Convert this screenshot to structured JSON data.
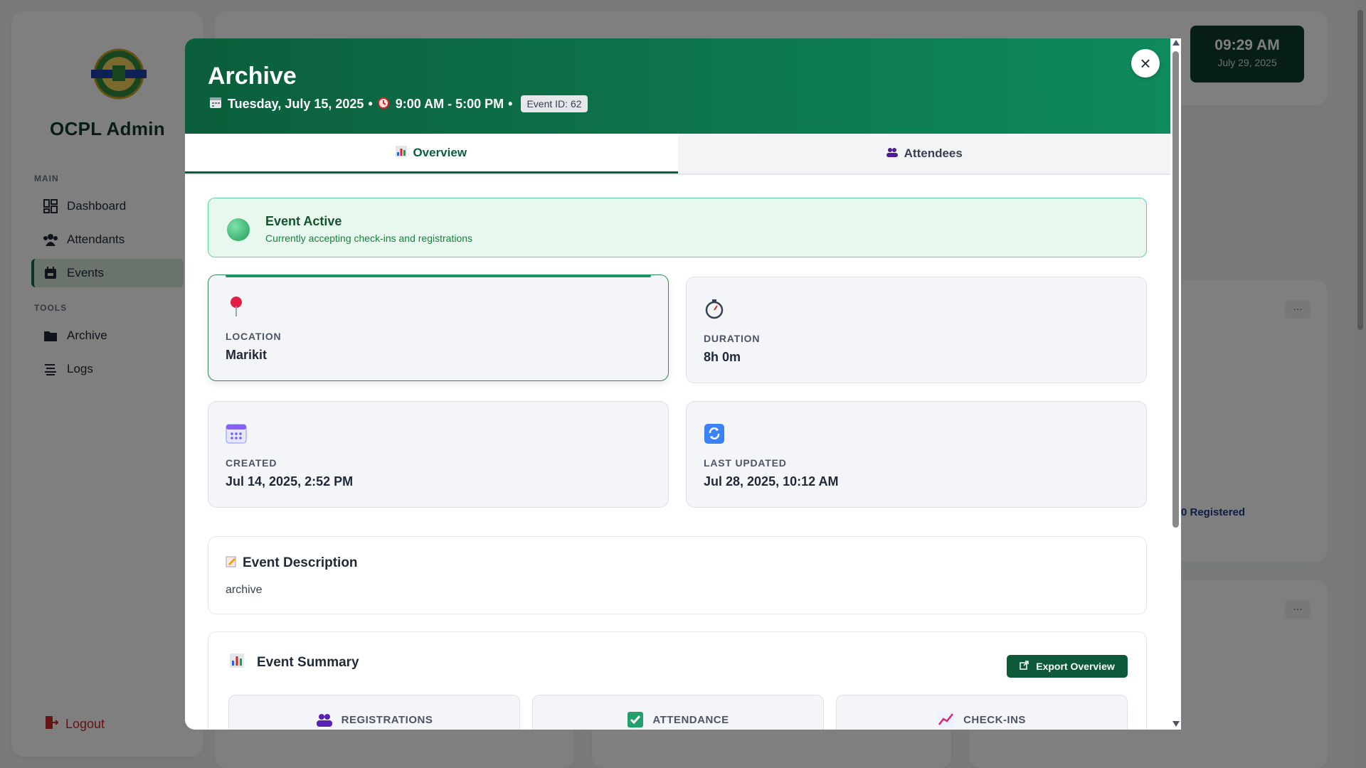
{
  "app": {
    "brand": "OCPL Admin",
    "logo_alt": "Olongapo City Public Library"
  },
  "sidebar": {
    "sections": [
      {
        "label": "MAIN",
        "items": [
          {
            "label": "Dashboard",
            "icon": "dashboard-icon",
            "active": false
          },
          {
            "label": "Attendants",
            "icon": "users-icon",
            "active": false
          },
          {
            "label": "Events",
            "icon": "calendar-icon",
            "active": true
          }
        ]
      },
      {
        "label": "TOOLS",
        "items": [
          {
            "label": "Archive",
            "icon": "folder-icon",
            "active": false
          },
          {
            "label": "Logs",
            "icon": "list-icon",
            "active": false
          }
        ]
      }
    ],
    "logout": "Logout"
  },
  "clock": {
    "time": "09:29 AM",
    "date": "July 29, 2025"
  },
  "background": {
    "registered": "0 Registered",
    "more": "..."
  },
  "modal": {
    "title": "Archive",
    "date": "Tuesday, July 15, 2025",
    "time": "9:00 AM - 5:00 PM",
    "bullet": "•",
    "event_id": "Event ID: 62",
    "close": "×",
    "tabs": [
      {
        "label": "Overview",
        "icon": "chart-icon",
        "active": true
      },
      {
        "label": "Attendees",
        "icon": "people-icon",
        "active": false
      }
    ],
    "status": {
      "title": "Event Active",
      "subtitle": "Currently accepting check-ins and registrations"
    },
    "info": {
      "location": {
        "label": "LOCATION",
        "value": "Marikit"
      },
      "duration": {
        "label": "DURATION",
        "value": "8h 0m"
      },
      "created": {
        "label": "CREATED",
        "value": "Jul 14, 2025, 2:52 PM"
      },
      "updated": {
        "label": "LAST UPDATED",
        "value": "Jul 28, 2025, 10:12 AM"
      }
    },
    "description": {
      "title": "Event Description",
      "text": "archive"
    },
    "summary": {
      "title": "Event Summary",
      "export": "Export Overview",
      "stats": [
        {
          "label": "REGISTRATIONS",
          "icon": "people-icon"
        },
        {
          "label": "ATTENDANCE",
          "icon": "check-icon"
        },
        {
          "label": "CHECK-INS",
          "icon": "trend-icon"
        }
      ]
    }
  },
  "colors": {
    "primary": "#0b5e3b",
    "accent": "#19965b",
    "danger": "#c62828",
    "active_bg": "#e8f8ef"
  }
}
